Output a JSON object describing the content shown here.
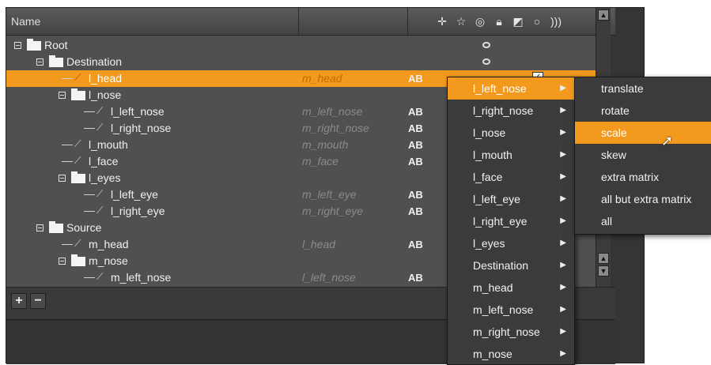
{
  "header": {
    "name_label": "Name",
    "icons": [
      "crosshair-icon",
      "transform-icon",
      "visibility-icon",
      "lock-icon",
      "matte-icon",
      "circle-icon",
      "spiral-icon"
    ]
  },
  "tree": [
    {
      "label": "Root",
      "type": "folder",
      "depth": 0,
      "target": "",
      "ab": "",
      "eye": true,
      "selected": false
    },
    {
      "label": "Destination",
      "type": "folder",
      "depth": 1,
      "target": "",
      "ab": "",
      "eye": true,
      "selected": false
    },
    {
      "label": "l_head",
      "type": "bone",
      "depth": 2,
      "target": "m_head",
      "ab": "AB",
      "eye": false,
      "selected": true
    },
    {
      "label": "l_nose",
      "type": "folder",
      "depth": 2,
      "target": "",
      "ab": "",
      "eye": false,
      "selected": false
    },
    {
      "label": "l_left_nose",
      "type": "bone",
      "depth": 3,
      "target": "m_left_nose",
      "ab": "AB",
      "eye": false,
      "selected": false
    },
    {
      "label": "l_right_nose",
      "type": "bone",
      "depth": 3,
      "target": "m_right_nose",
      "ab": "AB",
      "eye": false,
      "selected": false
    },
    {
      "label": "l_mouth",
      "type": "bone",
      "depth": 2,
      "target": "m_mouth",
      "ab": "AB",
      "eye": false,
      "selected": false
    },
    {
      "label": "l_face",
      "type": "bone",
      "depth": 2,
      "target": "m_face",
      "ab": "AB",
      "eye": false,
      "selected": false
    },
    {
      "label": "l_eyes",
      "type": "folder",
      "depth": 2,
      "target": "",
      "ab": "",
      "eye": false,
      "selected": false
    },
    {
      "label": "l_left_eye",
      "type": "bone",
      "depth": 3,
      "target": "m_left_eye",
      "ab": "AB",
      "eye": false,
      "selected": false
    },
    {
      "label": "l_right_eye",
      "type": "bone",
      "depth": 3,
      "target": "m_right_eye",
      "ab": "AB",
      "eye": false,
      "selected": false
    },
    {
      "label": "Source",
      "type": "folder",
      "depth": 1,
      "target": "",
      "ab": "",
      "eye": false,
      "selected": false
    },
    {
      "label": "m_head",
      "type": "bone",
      "depth": 2,
      "target": "l_head",
      "ab": "AB",
      "eye": false,
      "selected": false
    },
    {
      "label": "m_nose",
      "type": "folder",
      "depth": 2,
      "target": "",
      "ab": "",
      "eye": false,
      "selected": false
    },
    {
      "label": "m_left_nose",
      "type": "bone",
      "depth": 3,
      "target": "l_left_nose",
      "ab": "AB",
      "eye": false,
      "selected": false
    }
  ],
  "bottom": {
    "add_label": "+",
    "remove_label": "−"
  },
  "menu1": [
    {
      "label": "l_left_nose",
      "highlighted": true
    },
    {
      "label": "l_right_nose",
      "highlighted": false
    },
    {
      "label": "l_nose",
      "highlighted": false
    },
    {
      "label": "l_mouth",
      "highlighted": false
    },
    {
      "label": "l_face",
      "highlighted": false
    },
    {
      "label": "l_left_eye",
      "highlighted": false
    },
    {
      "label": "l_right_eye",
      "highlighted": false
    },
    {
      "label": "l_eyes",
      "highlighted": false
    },
    {
      "label": "Destination",
      "highlighted": false
    },
    {
      "label": "m_head",
      "highlighted": false
    },
    {
      "label": "m_left_nose",
      "highlighted": false
    },
    {
      "label": "m_right_nose",
      "highlighted": false
    },
    {
      "label": "m_nose",
      "highlighted": false
    }
  ],
  "menu2": [
    {
      "label": "translate",
      "highlighted": false
    },
    {
      "label": "rotate",
      "highlighted": false
    },
    {
      "label": "scale",
      "highlighted": true
    },
    {
      "label": "skew",
      "highlighted": false
    },
    {
      "label": "extra matrix",
      "highlighted": false
    },
    {
      "label": "all but extra matrix",
      "highlighted": false
    },
    {
      "label": "all",
      "highlighted": false
    }
  ],
  "colors": {
    "accent": "#f39a1e",
    "panel": "#505050",
    "menu": "#3b3b3b"
  }
}
